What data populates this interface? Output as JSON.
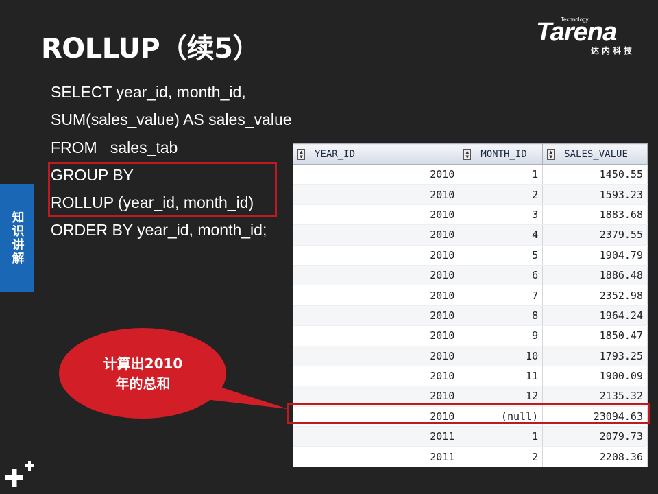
{
  "slide": {
    "title": "ROLLUP（续5）",
    "side_tab": "知识讲解"
  },
  "logo": {
    "tech": "Technology",
    "word": "Tarena",
    "cn": "达内科技"
  },
  "code_lines": [
    "SELECT year_id, month_id,",
    "SUM(sales_value) AS sales_value",
    "FROM   sales_tab",
    "GROUP BY",
    "ROLLUP (year_id, month_id)",
    "ORDER BY year_id, month_id;"
  ],
  "table": {
    "headers": [
      "YEAR_ID",
      "MONTH_ID",
      "SALES_VALUE"
    ],
    "rows": [
      [
        "2010",
        "1",
        "1450.55"
      ],
      [
        "2010",
        "2",
        "1593.23"
      ],
      [
        "2010",
        "3",
        "1883.68"
      ],
      [
        "2010",
        "4",
        "2379.55"
      ],
      [
        "2010",
        "5",
        "1904.79"
      ],
      [
        "2010",
        "6",
        "1886.48"
      ],
      [
        "2010",
        "7",
        "2352.98"
      ],
      [
        "2010",
        "8",
        "1964.24"
      ],
      [
        "2010",
        "9",
        "1850.47"
      ],
      [
        "2010",
        "10",
        "1793.25"
      ],
      [
        "2010",
        "11",
        "1900.09"
      ],
      [
        "2010",
        "12",
        "2135.32"
      ],
      [
        "2010",
        "(null)",
        "23094.63"
      ],
      [
        "2011",
        "1",
        "2079.73"
      ],
      [
        "2011",
        "2",
        "2208.36"
      ]
    ]
  },
  "callout": {
    "line1": "计算出2010",
    "line2": "年的总和"
  },
  "colors": {
    "background": "#232323",
    "highlight": "#c0191f",
    "side_tab": "#1a67b5",
    "callout": "#d21e26"
  }
}
